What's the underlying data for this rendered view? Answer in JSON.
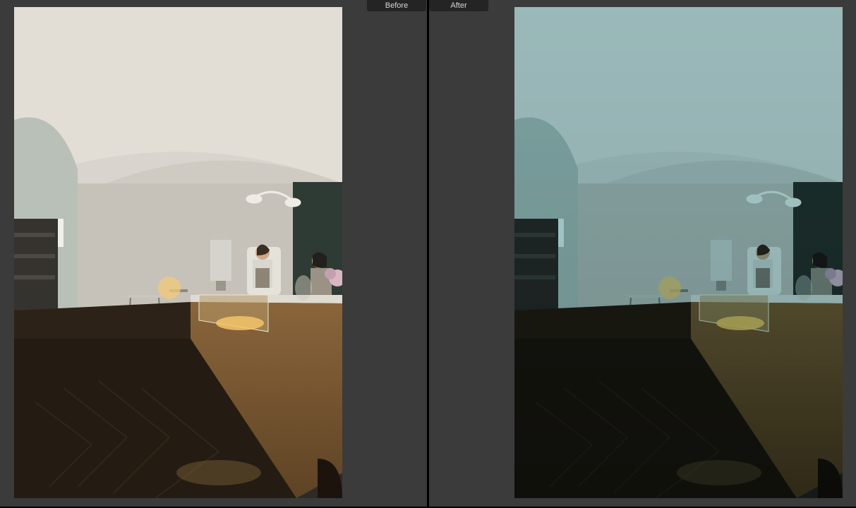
{
  "labels": {
    "before": "Before",
    "after": "After"
  },
  "scene": {
    "description": "Café interior with wooden counter, two baristas, arched doorway, herringbone wood floor, shelving on left wall and hanging wall lamps.",
    "before_grade": "neutral warm",
    "after_grade": "cool teal"
  }
}
